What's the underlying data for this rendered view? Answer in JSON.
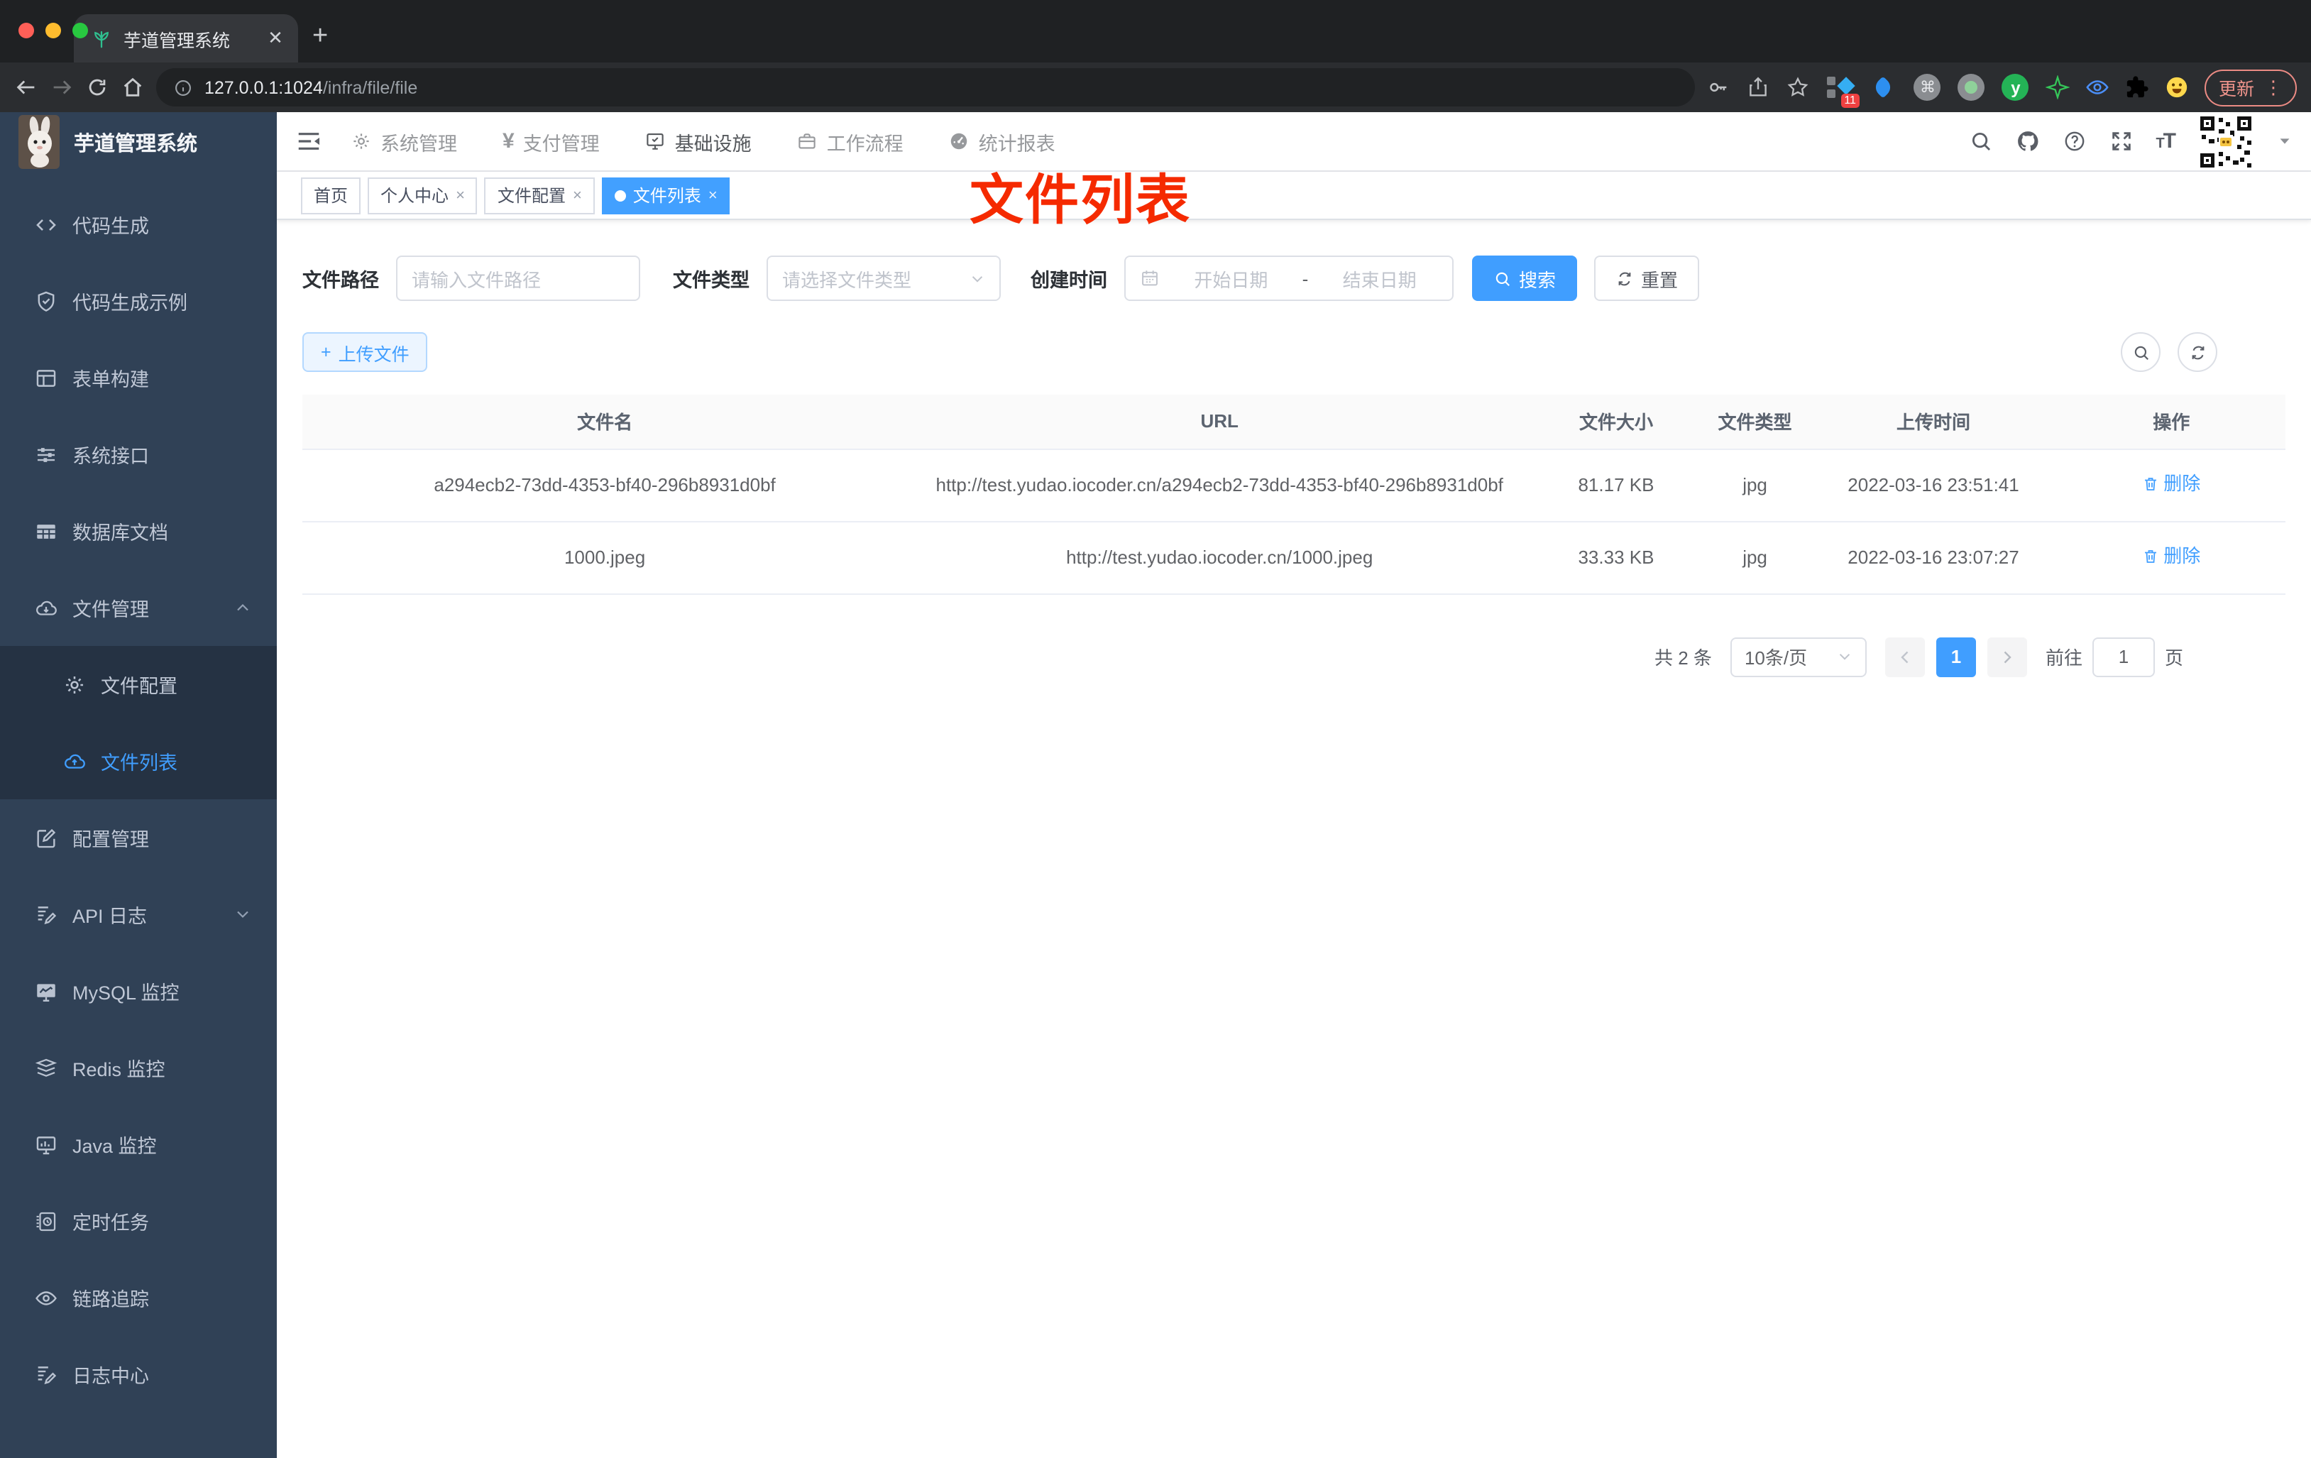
{
  "browser": {
    "tab_title": "芋道管理系统",
    "close_label": "✕",
    "url_host": "127.0.0.1:1024",
    "url_path": "/infra/file/file",
    "extension_badge": "11",
    "update_label": "更新"
  },
  "header": {
    "app_title": "芋道管理系统",
    "nav": [
      {
        "label": "系统管理"
      },
      {
        "label": "支付管理"
      },
      {
        "label": "基础设施"
      },
      {
        "label": "工作流程"
      },
      {
        "label": "统计报表"
      }
    ],
    "yen_glyph": "¥"
  },
  "sidebar": {
    "items": [
      {
        "label": "代码生成"
      },
      {
        "label": "代码生成示例"
      },
      {
        "label": "表单构建"
      },
      {
        "label": "系统接口"
      },
      {
        "label": "数据库文档"
      },
      {
        "label": "文件管理"
      },
      {
        "label": "文件配置"
      },
      {
        "label": "文件列表"
      },
      {
        "label": "配置管理"
      },
      {
        "label": "API 日志"
      },
      {
        "label": "MySQL 监控"
      },
      {
        "label": "Redis 监控"
      },
      {
        "label": "Java 监控"
      },
      {
        "label": "定时任务"
      },
      {
        "label": "链路追踪"
      },
      {
        "label": "日志中心"
      }
    ]
  },
  "tags": [
    {
      "label": "首页"
    },
    {
      "label": "个人中心",
      "close": "×"
    },
    {
      "label": "文件配置",
      "close": "×"
    },
    {
      "label": "文件列表",
      "close": "×"
    }
  ],
  "annotation": "文件列表",
  "filters": {
    "path_label": "文件路径",
    "path_placeholder": "请输入文件路径",
    "type_label": "文件类型",
    "type_placeholder": "请选择文件类型",
    "date_label": "创建时间",
    "date_start": "开始日期",
    "date_separator": "-",
    "date_end": "结束日期",
    "search_label": "搜索",
    "reset_label": "重置"
  },
  "toolbar": {
    "upload_label": "上传文件",
    "plus_glyph": "+"
  },
  "table": {
    "headers": [
      "文件名",
      "URL",
      "文件大小",
      "文件类型",
      "上传时间",
      "操作"
    ],
    "rows": [
      {
        "name": "a294ecb2-73dd-4353-bf40-296b8931d0bf",
        "url": "http://test.yudao.iocoder.cn/a294ecb2-73dd-4353-bf40-296b8931d0bf",
        "size": "81.17 KB",
        "type": "jpg",
        "time": "2022-03-16 23:51:41",
        "action": "删除"
      },
      {
        "name": "1000.jpeg",
        "url": "http://test.yudao.iocoder.cn/1000.jpeg",
        "size": "33.33 KB",
        "type": "jpg",
        "time": "2022-03-16 23:07:27",
        "action": "删除"
      }
    ]
  },
  "pagination": {
    "total": "共 2 条",
    "page_size": "10条/页",
    "current_page": "1",
    "goto_label": "前往",
    "goto_value": "1",
    "page_unit": "页"
  },
  "colors": {
    "accent": "#409eff",
    "sidebar_bg": "#304156",
    "annotation_red": "#f52a00",
    "active_tag": "#42a0ff"
  }
}
